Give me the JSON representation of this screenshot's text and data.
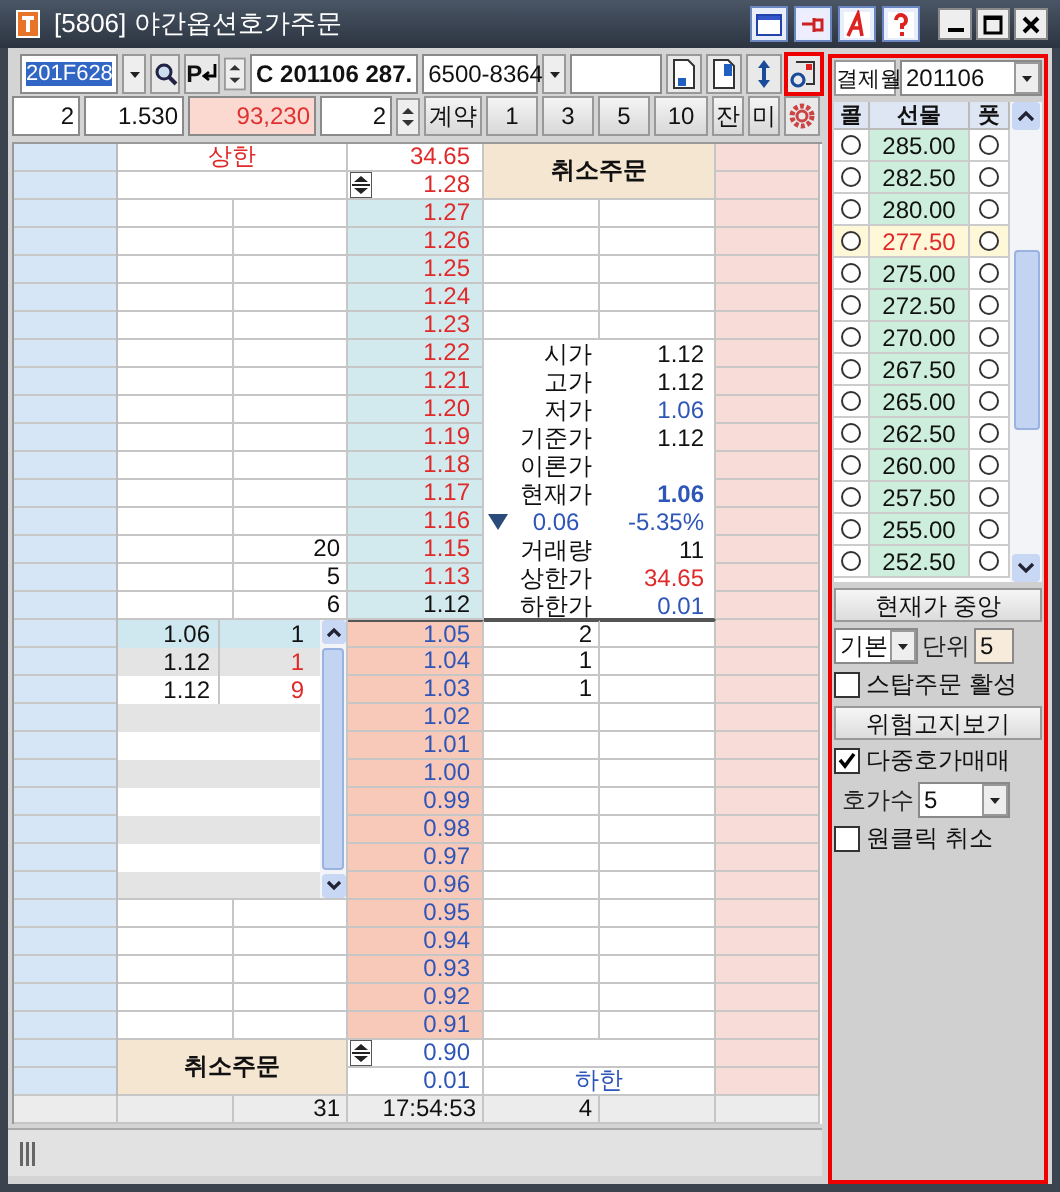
{
  "window": {
    "title": "[5806] 야간옵션호가주문"
  },
  "toolbar": {
    "code": "201F628",
    "account": "6500-8364",
    "option": "C 201106 287.",
    "enter_label": "P",
    "qty": "2",
    "multiplier": "1.530",
    "amount": "93,230",
    "order_qty": "2",
    "buttons": [
      "계약",
      "1",
      "3",
      "5",
      "10",
      "잔",
      "미"
    ]
  },
  "ladder": {
    "upper_label": "상한",
    "cancel_top": "취소주문",
    "cancel_bottom": "취소주문",
    "lower_label": "하한",
    "rows": [
      {
        "price": "34.65",
        "color": "#e02a2a",
        "kind": "limit"
      },
      {
        "price": "1.28",
        "color": "#e02a2a",
        "kind": "limit"
      },
      {
        "price": "1.27",
        "color": "#e02a2a",
        "kind": "ask"
      },
      {
        "price": "1.26",
        "color": "#e02a2a",
        "kind": "ask"
      },
      {
        "price": "1.25",
        "color": "#e02a2a",
        "kind": "ask"
      },
      {
        "price": "1.24",
        "color": "#e02a2a",
        "kind": "ask"
      },
      {
        "price": "1.23",
        "color": "#e02a2a",
        "kind": "ask"
      },
      {
        "price": "1.22",
        "color": "#e02a2a",
        "kind": "ask"
      },
      {
        "price": "1.21",
        "color": "#e02a2a",
        "kind": "ask"
      },
      {
        "price": "1.20",
        "color": "#e02a2a",
        "kind": "ask"
      },
      {
        "price": "1.19",
        "color": "#e02a2a",
        "kind": "ask"
      },
      {
        "price": "1.18",
        "color": "#e02a2a",
        "kind": "ask"
      },
      {
        "price": "1.17",
        "color": "#e02a2a",
        "kind": "ask"
      },
      {
        "price": "1.16",
        "color": "#e02a2a",
        "kind": "ask"
      },
      {
        "price": "1.15",
        "color": "#e02a2a",
        "kind": "ask",
        "ask_qty": "20"
      },
      {
        "price": "1.13",
        "color": "#e02a2a",
        "kind": "ask",
        "ask_qty": "5"
      },
      {
        "price": "1.12",
        "color": "#111111",
        "kind": "ask",
        "ask_qty": "6"
      },
      {
        "price": "1.05",
        "color": "#2e55b8",
        "kind": "bid",
        "bid_qty": "2"
      },
      {
        "price": "1.04",
        "color": "#2e55b8",
        "kind": "bid",
        "bid_qty": "1"
      },
      {
        "price": "1.03",
        "color": "#2e55b8",
        "kind": "bid",
        "bid_qty": "1"
      },
      {
        "price": "1.02",
        "color": "#2e55b8",
        "kind": "bid"
      },
      {
        "price": "1.01",
        "color": "#2e55b8",
        "kind": "bid"
      },
      {
        "price": "1.00",
        "color": "#2e55b8",
        "kind": "bid"
      },
      {
        "price": "0.99",
        "color": "#2e55b8",
        "kind": "bid"
      },
      {
        "price": "0.98",
        "color": "#2e55b8",
        "kind": "bid"
      },
      {
        "price": "0.97",
        "color": "#2e55b8",
        "kind": "bid"
      },
      {
        "price": "0.96",
        "color": "#2e55b8",
        "kind": "bid"
      },
      {
        "price": "0.95",
        "color": "#2e55b8",
        "kind": "bid"
      },
      {
        "price": "0.94",
        "color": "#2e55b8",
        "kind": "bid"
      },
      {
        "price": "0.93",
        "color": "#2e55b8",
        "kind": "bid"
      },
      {
        "price": "0.92",
        "color": "#2e55b8",
        "kind": "bid"
      },
      {
        "price": "0.91",
        "color": "#2e55b8",
        "kind": "bid"
      },
      {
        "price": "0.90",
        "color": "#2e55b8",
        "kind": "limit"
      },
      {
        "price": "0.01",
        "color": "#2e55b8",
        "kind": "limit"
      }
    ],
    "info": [
      {
        "kind": "plain",
        "label": "시가",
        "value": "1.12",
        "color": "#111111"
      },
      {
        "kind": "plain",
        "label": "고가",
        "value": "1.12",
        "color": "#111111"
      },
      {
        "kind": "plain",
        "label": "저가",
        "value": "1.06",
        "color": "#2e55b8"
      },
      {
        "kind": "plain",
        "label": "기준가",
        "value": "1.12",
        "color": "#111111"
      },
      {
        "kind": "plain",
        "label": "이론가"
      },
      {
        "kind": "current",
        "label": "현재가",
        "value": "1.06",
        "color": "#2e55b8"
      },
      {
        "kind": "change",
        "value": "0.06",
        "rate": "-5.35%",
        "color": "#2e55b8"
      },
      {
        "kind": "plain",
        "label": "거래량",
        "value": "11",
        "color": "#111111"
      },
      {
        "kind": "plain",
        "label": "상한가",
        "value": "34.65",
        "color": "#e02a2a"
      },
      {
        "kind": "plain",
        "label": "하한가",
        "value": "0.01",
        "color": "#2e55b8"
      }
    ],
    "trades": [
      {
        "price": "1.06",
        "qty": "1",
        "color": "#111111",
        "selected": true
      },
      {
        "price": "1.12",
        "qty": "1",
        "color": "#e02a2a",
        "selected": false
      },
      {
        "price": "1.12",
        "qty": "9",
        "color": "#e02a2a",
        "selected": false
      }
    ],
    "footer": {
      "ask_total": "31",
      "time": "17:54:53",
      "bid_total": "4"
    }
  },
  "panel": {
    "settlement_label": "결제월",
    "settlement": "201106",
    "columns": [
      "콜",
      "선물",
      "풋"
    ],
    "strikes": [
      {
        "strike": "285.00",
        "highlighted": false,
        "call_checked": false,
        "put_checked": false
      },
      {
        "strike": "282.50",
        "highlighted": false,
        "call_checked": false,
        "put_checked": false
      },
      {
        "strike": "280.00",
        "highlighted": false,
        "call_checked": false,
        "put_checked": false
      },
      {
        "strike": "277.50",
        "highlighted": true,
        "call_checked": false,
        "put_checked": false
      },
      {
        "strike": "275.00",
        "highlighted": false,
        "call_checked": false,
        "put_checked": false
      },
      {
        "strike": "272.50",
        "highlighted": false,
        "call_checked": false,
        "put_checked": false
      },
      {
        "strike": "270.00",
        "highlighted": false,
        "call_checked": false,
        "put_checked": false
      },
      {
        "strike": "267.50",
        "highlighted": false,
        "call_checked": false,
        "put_checked": false
      },
      {
        "strike": "265.00",
        "highlighted": false,
        "call_checked": false,
        "put_checked": false
      },
      {
        "strike": "262.50",
        "highlighted": false,
        "call_checked": false,
        "put_checked": false
      },
      {
        "strike": "260.00",
        "highlighted": false,
        "call_checked": false,
        "put_checked": false
      },
      {
        "strike": "257.50",
        "highlighted": false,
        "call_checked": false,
        "put_checked": false
      },
      {
        "strike": "255.00",
        "highlighted": false,
        "call_checked": false,
        "put_checked": false
      },
      {
        "strike": "252.50",
        "highlighted": false,
        "call_checked": false,
        "put_checked": false
      }
    ],
    "center_button": "현재가 중앙",
    "mode": "기본",
    "unit_label": "단위",
    "unit": "5",
    "stop_order": {
      "label": "스탑주문 활성",
      "checked": false
    },
    "risk_button": "위험고지보기",
    "multi": {
      "label": "다중호가매매",
      "checked": true
    },
    "depth_label": "호가수",
    "depth": "5",
    "one_click": {
      "label": "원클릭 취소",
      "checked": false
    }
  }
}
